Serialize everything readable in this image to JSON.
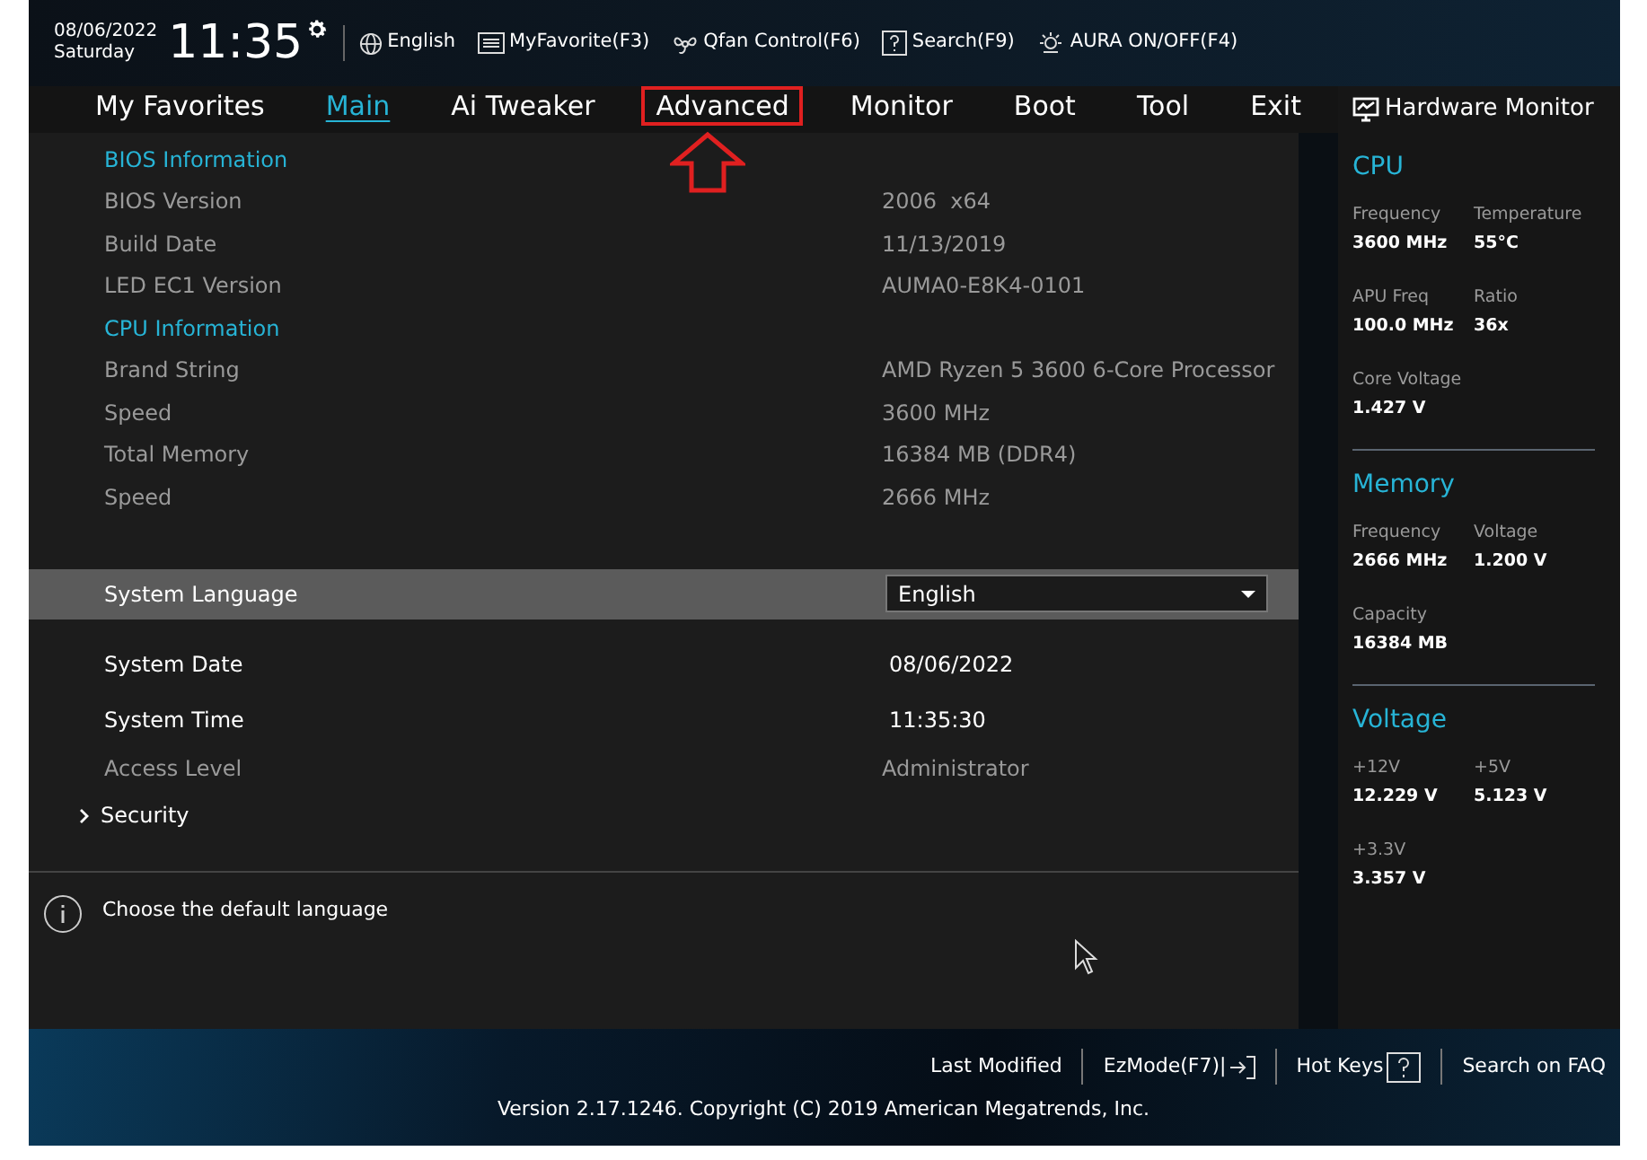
{
  "header": {
    "date": "08/06/2022",
    "weekday": "Saturday",
    "time": "11:35",
    "tools": [
      {
        "kind": "globe",
        "label": "English"
      },
      {
        "kind": "favorite",
        "label": "MyFavorite(F3)"
      },
      {
        "kind": "fan",
        "label": "Qfan Control(F6)"
      },
      {
        "kind": "search",
        "label": "Search(F9)"
      },
      {
        "kind": "aura",
        "label": "AURA ON/OFF(F4)"
      }
    ]
  },
  "tabs": [
    {
      "label": "My Favorites",
      "selected": false,
      "annotated": false
    },
    {
      "label": "Main",
      "selected": true,
      "annotated": false
    },
    {
      "label": "Ai Tweaker",
      "selected": false,
      "annotated": false
    },
    {
      "label": "Advanced",
      "selected": false,
      "annotated": true
    },
    {
      "label": "Monitor",
      "selected": false,
      "annotated": false
    },
    {
      "label": "Boot",
      "selected": false,
      "annotated": false
    },
    {
      "label": "Tool",
      "selected": false,
      "annotated": false
    },
    {
      "label": "Exit",
      "selected": false,
      "annotated": false
    }
  ],
  "rows": [
    {
      "kind": "section",
      "label": "BIOS Information"
    },
    {
      "kind": "info",
      "label": "BIOS Version",
      "value": "2006  x64"
    },
    {
      "kind": "info",
      "label": "Build Date",
      "value": "11/13/2019"
    },
    {
      "kind": "info",
      "label": "LED EC1 Version",
      "value": "AUMA0-E8K4-0101"
    },
    {
      "kind": "section",
      "label": "CPU Information"
    },
    {
      "kind": "info",
      "label": "Brand String",
      "value": "AMD Ryzen 5 3600 6-Core Processor"
    },
    {
      "kind": "info",
      "label": "Speed",
      "value": "3600 MHz"
    },
    {
      "kind": "info",
      "label": "Total Memory",
      "value": "16384 MB (DDR4)"
    },
    {
      "kind": "info",
      "label": "Speed",
      "value": "2666 MHz"
    },
    {
      "kind": "select",
      "label": "System Language",
      "value": "English",
      "selected": true
    },
    {
      "kind": "edit",
      "label": "System Date",
      "value": "08/06/2022"
    },
    {
      "kind": "edit",
      "label": "System Time",
      "value": "11:35:30"
    },
    {
      "kind": "info",
      "label": "Access Level",
      "value": "Administrator"
    },
    {
      "kind": "submenu",
      "label": "Security"
    }
  ],
  "help": "Choose the default language",
  "monitor": {
    "title": "Hardware Monitor",
    "sections": [
      {
        "title": "CPU",
        "items": [
          {
            "label": "Frequency",
            "value": "3600 MHz"
          },
          {
            "label": "Temperature",
            "value": "55°C"
          },
          {
            "label": "APU Freq",
            "value": "100.0 MHz"
          },
          {
            "label": "Ratio",
            "value": "36x"
          },
          {
            "label": "Core Voltage",
            "value": "1.427 V"
          }
        ]
      },
      {
        "title": "Memory",
        "items": [
          {
            "label": "Frequency",
            "value": "2666 MHz"
          },
          {
            "label": "Voltage",
            "value": "1.200 V"
          },
          {
            "label": "Capacity",
            "value": "16384 MB"
          }
        ]
      },
      {
        "title": "Voltage",
        "items": [
          {
            "label": "+12V",
            "value": "12.229 V"
          },
          {
            "label": "+5V",
            "value": "5.123 V"
          },
          {
            "label": "+3.3V",
            "value": "3.357 V"
          }
        ]
      }
    ]
  },
  "footer": {
    "links": [
      {
        "kind": "plain",
        "label": "Last Modified"
      },
      {
        "kind": "exit",
        "label": "EzMode(F7)|"
      },
      {
        "kind": "help",
        "label": "Hot Keys"
      },
      {
        "kind": "plain",
        "label": "Search on FAQ"
      }
    ],
    "version": "Version 2.17.1246. Copyright (C) 2019 American Megatrends, Inc."
  }
}
